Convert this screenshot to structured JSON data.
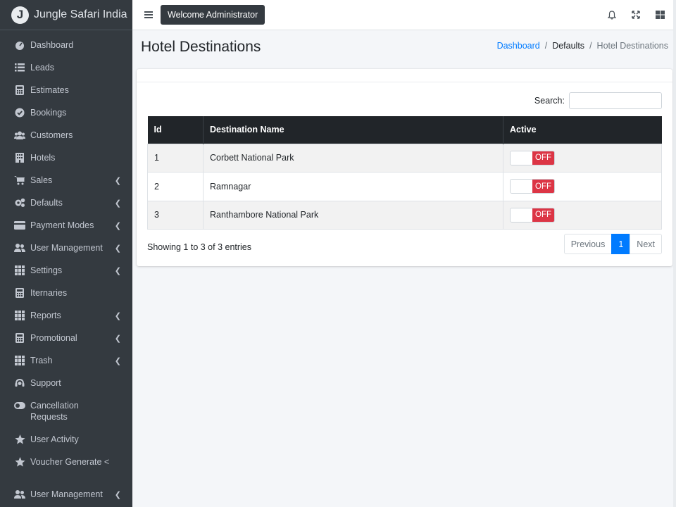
{
  "brand": {
    "logo_letter": "J",
    "name": "Jungle Safari India"
  },
  "sidebar": {
    "items": [
      {
        "label": "Dashboard",
        "icon": "dashboard-icon",
        "chevron": false
      },
      {
        "label": "Leads",
        "icon": "list-icon",
        "chevron": false
      },
      {
        "label": "Estimates",
        "icon": "calculator-icon",
        "chevron": false
      },
      {
        "label": "Bookings",
        "icon": "check-circle-icon",
        "chevron": false
      },
      {
        "label": "Customers",
        "icon": "users-icon",
        "chevron": false
      },
      {
        "label": "Hotels",
        "icon": "building-icon",
        "chevron": false
      },
      {
        "label": "Sales",
        "icon": "cart-icon",
        "chevron": true
      },
      {
        "label": "Defaults",
        "icon": "cogs-icon",
        "chevron": true
      },
      {
        "label": "Payment Modes",
        "icon": "credit-card-icon",
        "chevron": true
      },
      {
        "label": "User Management",
        "icon": "user-group-icon",
        "chevron": true
      },
      {
        "label": "Settings",
        "icon": "grid-icon",
        "chevron": true
      },
      {
        "label": "Iternaries",
        "icon": "calculator-icon",
        "chevron": false
      },
      {
        "label": "Reports",
        "icon": "grid-icon",
        "chevron": true
      },
      {
        "label": "Promotional",
        "icon": "calculator-icon",
        "chevron": true
      },
      {
        "label": "Trash",
        "icon": "grid-icon",
        "chevron": true
      },
      {
        "label": "Support",
        "icon": "headset-icon",
        "chevron": false
      },
      {
        "label": "Cancellation Requests",
        "icon": "toggle-icon",
        "chevron": false
      },
      {
        "label": "User Activity",
        "icon": "star-icon",
        "chevron": false
      },
      {
        "label": "Voucher Generate <",
        "icon": "star-icon",
        "chevron": false
      },
      {
        "label": "User Management",
        "icon": "user-group-icon",
        "chevron": true
      }
    ]
  },
  "topbar": {
    "welcome": "Welcome Administrator"
  },
  "page": {
    "title": "Hotel Destinations"
  },
  "breadcrumb": {
    "items": [
      "Dashboard",
      "Defaults",
      "Hotel Destinations"
    ],
    "separator": "/"
  },
  "table": {
    "search_label": "Search:",
    "columns": [
      "Id",
      "Destination Name",
      "Active"
    ],
    "rows": [
      {
        "id": "1",
        "name": "Corbett National Park",
        "active": "OFF"
      },
      {
        "id": "2",
        "name": "Ramnagar",
        "active": "OFF"
      },
      {
        "id": "3",
        "name": "Ranthambore National Park",
        "active": "OFF"
      }
    ],
    "info": "Showing 1 to 3 of 3 entries"
  },
  "pagination": {
    "previous": "Previous",
    "page": "1",
    "next": "Next"
  },
  "colors": {
    "sidebar_bg": "#343a40",
    "accent": "#007bff",
    "off_badge": "#dc3545",
    "table_header": "#212529"
  }
}
